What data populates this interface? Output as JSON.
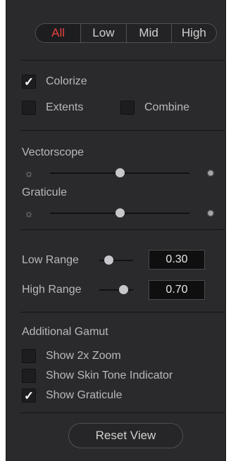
{
  "segment": {
    "tabs": [
      {
        "label": "All",
        "active": true
      },
      {
        "label": "Low",
        "active": false
      },
      {
        "label": "Mid",
        "active": false
      },
      {
        "label": "High",
        "active": false
      }
    ]
  },
  "options": {
    "colorize": {
      "label": "Colorize",
      "checked": true
    },
    "extents": {
      "label": "Extents",
      "checked": false
    },
    "combine": {
      "label": "Combine",
      "checked": false
    }
  },
  "brightness": {
    "vectorscope": {
      "label": "Vectorscope",
      "level": 0.5
    },
    "graticule": {
      "label": "Graticule",
      "level": 0.5
    }
  },
  "range": {
    "low": {
      "label": "Low Range",
      "value": "0.30"
    },
    "high": {
      "label": "High Range",
      "value": "0.70"
    }
  },
  "gamut": {
    "title": "Additional Gamut",
    "items": [
      {
        "label": "Show 2x Zoom",
        "checked": false
      },
      {
        "label": "Show Skin Tone Indicator",
        "checked": false
      },
      {
        "label": "Show Graticule",
        "checked": true
      }
    ]
  },
  "reset_label": "Reset View",
  "icons": {
    "dim": "sun-outline-icon",
    "bright": "sun-filled-icon"
  },
  "colors": {
    "accent": "#e8413f",
    "panel": "#2a2a2d"
  }
}
